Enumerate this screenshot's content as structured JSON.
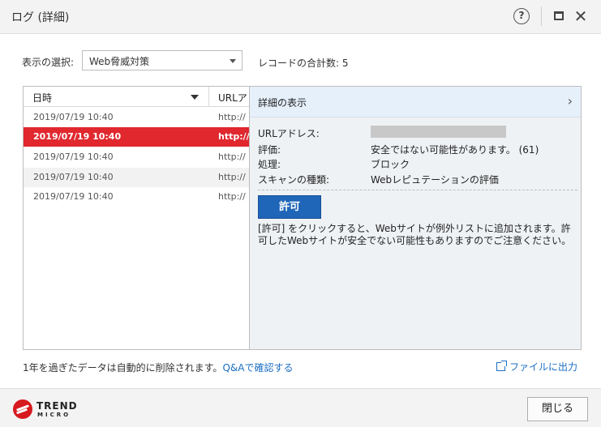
{
  "window": {
    "title": "ログ (詳細)",
    "help_glyph": "?",
    "close_glyph": "✕"
  },
  "filter": {
    "label": "表示の選択:",
    "selected": "Web脅威対策",
    "total_label": "レコードの合計数: 5"
  },
  "list": {
    "columns": {
      "date": "日時",
      "url": "URLア"
    },
    "rows": [
      {
        "date": "2019/07/19 10:40",
        "url": "http://",
        "selected": false
      },
      {
        "date": "2019/07/19 10:40",
        "url": "http://",
        "selected": true
      },
      {
        "date": "2019/07/19 10:40",
        "url": "http://",
        "selected": false
      },
      {
        "date": "2019/07/19 10:40",
        "url": "http://",
        "selected": false
      },
      {
        "date": "2019/07/19 10:40",
        "url": "http://",
        "selected": false
      }
    ]
  },
  "detail": {
    "header": "詳細の表示",
    "chevron": "›",
    "fields": {
      "url_label": "URLアドレス:",
      "rating_label": "評価:",
      "rating_value": "安全ではない可能性があります。 (61)",
      "action_label": "処理:",
      "action_value": "ブロック",
      "scan_label": "スキャンの種類:",
      "scan_value": "Webレピュテーションの評価"
    },
    "allow_button": "許可",
    "note": "[許可] をクリックすると、Webサイトが例外リストに追加されます。許可したWebサイトが安全でない可能性もありますのでご注意ください。"
  },
  "footer": {
    "retention_note": "1年を過ぎたデータは自動的に削除されます。",
    "qa_link": "Q&Aで確認する",
    "export_link": "ファイルに出力",
    "logo_line1": "TREND",
    "logo_line2": "MICRO",
    "close_button": "閉じる"
  },
  "colors": {
    "selected_row": "#e0282e",
    "allow_button": "#1f66b8",
    "link": "#1c6fc4"
  }
}
